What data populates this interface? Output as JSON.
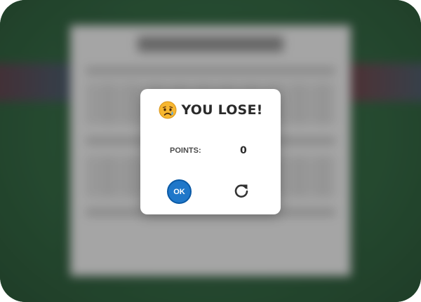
{
  "game": {
    "result_title": "YOU LOSE!",
    "result_emoji_icon": "sad-tear-face-icon",
    "points_label": "POINTS:",
    "points_value": "0",
    "ok_label": "OK",
    "restart_icon": "restart-icon"
  },
  "colors": {
    "felt_green": "#245633",
    "ok_button_blue": "#1f77c9",
    "modal_background": "#ffffff",
    "text_dark": "#2a2a2a"
  }
}
